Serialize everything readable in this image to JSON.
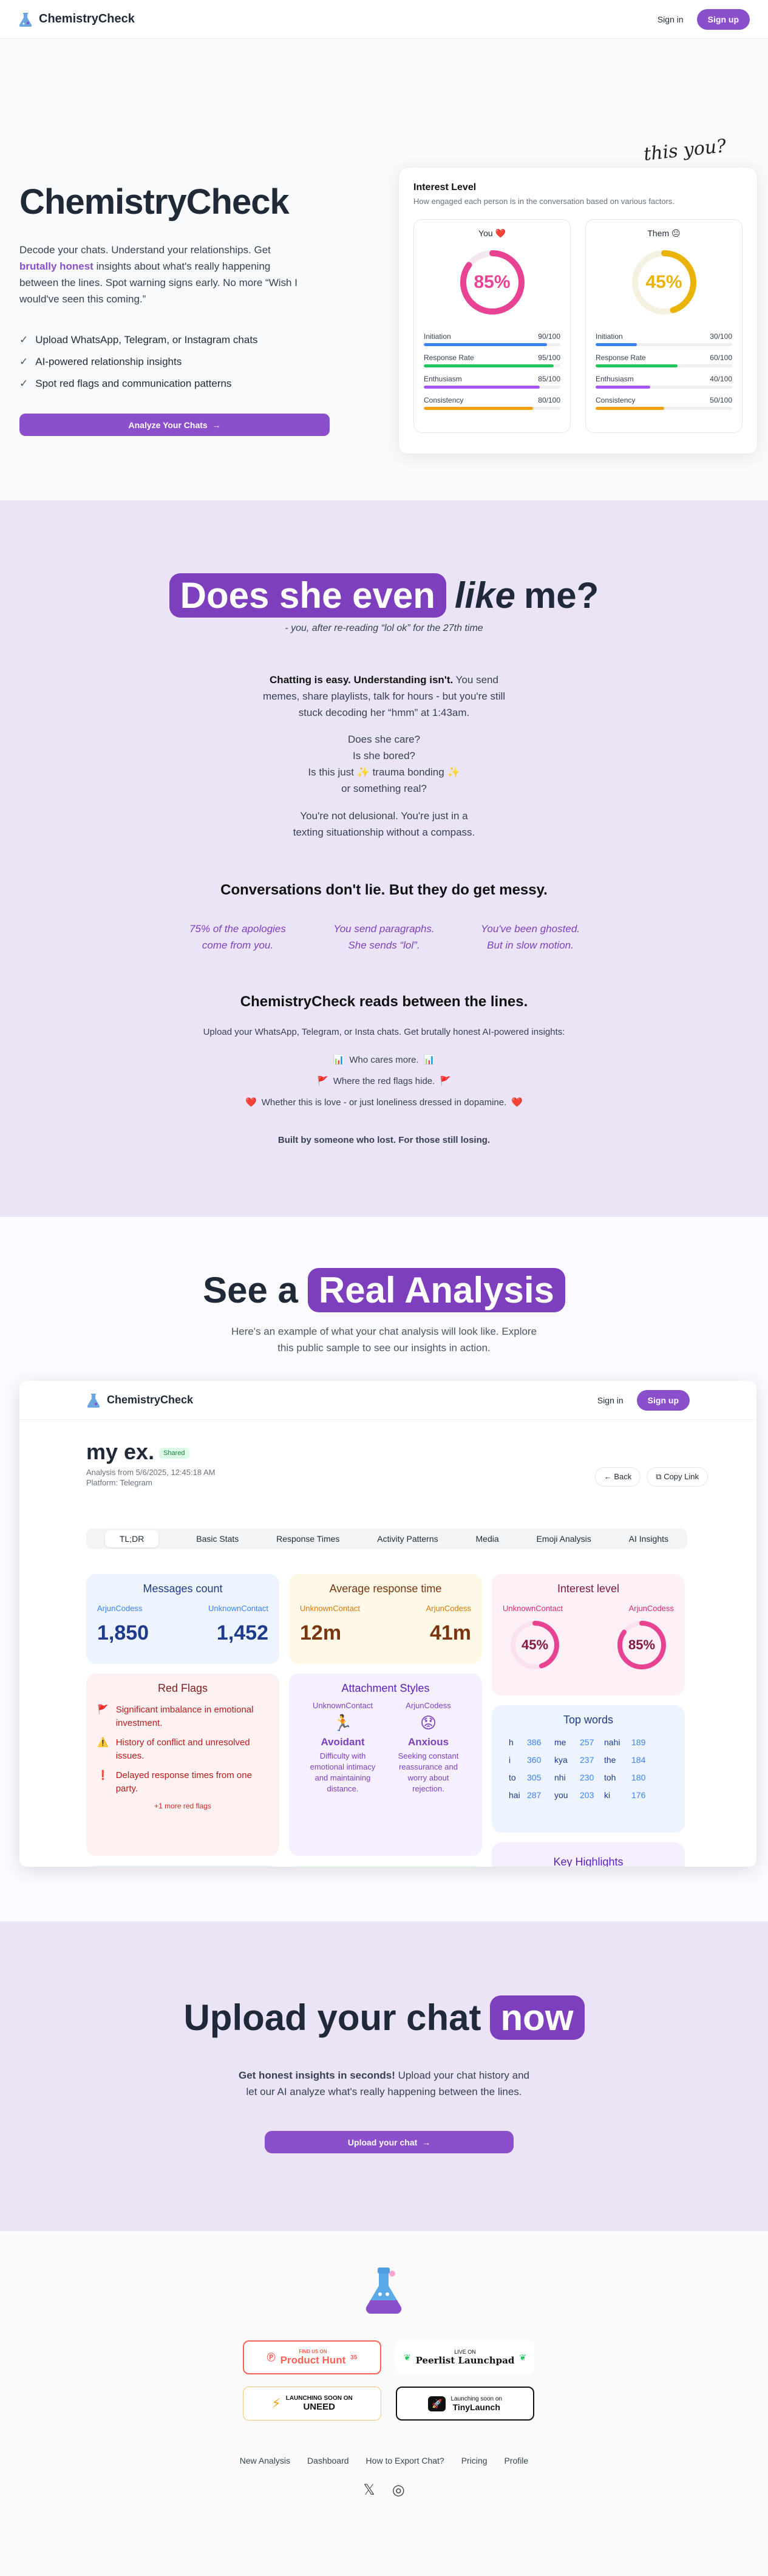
{
  "nav": {
    "brand": "ChemistryCheck",
    "signin": "Sign in",
    "signup": "Sign up"
  },
  "hero": {
    "title": "ChemistryCheck",
    "p1": "Decode your chats. Understand your relationships. Get ",
    "p_bold": "brutally honest",
    "p2": " insights about what's really happening between the lines. Spot warning signs early. No more “Wish I would've seen this coming.”",
    "checks": [
      "Upload WhatsApp, Telegram, or Instagram chats",
      "AI-powered relationship insights",
      "Spot red flags and communication patterns"
    ],
    "cta": "Analyze Your Chats"
  },
  "interest": {
    "handwritten": "this you?",
    "title": "Interest Level",
    "subtitle": "How engaged each person is in the conversation based on various factors.",
    "people": [
      {
        "name": "You ❤️",
        "percent": "85%",
        "value": 85,
        "color": "#e84393",
        "metrics": [
          {
            "label": "Initiation",
            "value": "90/100",
            "fill": 90,
            "color": "#3b82f6"
          },
          {
            "label": "Response Rate",
            "value": "95/100",
            "fill": 95,
            "color": "#22c55e"
          },
          {
            "label": "Enthusiasm",
            "value": "85/100",
            "fill": 85,
            "color": "#a855f7"
          },
          {
            "label": "Consistency",
            "value": "80/100",
            "fill": 80,
            "color": "#f59e0b"
          }
        ]
      },
      {
        "name": "Them 😐",
        "percent": "45%",
        "value": 45,
        "color": "#eab308",
        "metrics": [
          {
            "label": "Initiation",
            "value": "30/100",
            "fill": 30,
            "color": "#3b82f6"
          },
          {
            "label": "Response Rate",
            "value": "60/100",
            "fill": 60,
            "color": "#22c55e"
          },
          {
            "label": "Enthusiasm",
            "value": "40/100",
            "fill": 40,
            "color": "#a855f7"
          },
          {
            "label": "Consistency",
            "value": "50/100",
            "fill": 50,
            "color": "#f59e0b"
          }
        ]
      }
    ]
  },
  "story": {
    "head_pill": "Does she even",
    "head_em": "like",
    "head_end": "me?",
    "quote": "- you, after re-reading “lol ok” for the 27th time",
    "b1_bold": "Chatting is easy. Understanding isn't.",
    "b1_rest": " You send memes, share playlists, talk for hours - but you're still stuck decoding her “hmm” at 1:43am.",
    "b2": [
      "Does she care?",
      "Is she bored?",
      "Is this just ✨ trauma bonding ✨",
      "or something real?"
    ],
    "b3": [
      "You're not delusional. You're just in a",
      "texting situationship without a compass."
    ],
    "h2": "Conversations don't lie. But they do get messy.",
    "quotes": [
      "75% of the apologies come from you.",
      "You send paragraphs. She sends “lol”.",
      "You've been ghosted. But in slow motion."
    ],
    "h3": "ChemistryCheck reads between the lines.",
    "p3": "Upload your WhatsApp, Telegram, or Insta chats. Get brutally honest AI-powered insights:",
    "items": [
      {
        "icon": "📊",
        "text": "Who cares more."
      },
      {
        "icon": "🚩",
        "text": "Where the red flags hide."
      },
      {
        "icon": "❤️",
        "text": "Whether this is love - or just loneliness dressed in dopamine."
      }
    ],
    "closing": "Built by someone who lost. For those still losing."
  },
  "sample": {
    "head_a": "See a",
    "head_pill": "Real Analysis",
    "sub": [
      "Here's an example of what your chat analysis will look like. Explore",
      "this public sample to see our insights in action."
    ],
    "title": "my ex.",
    "shared": "Shared",
    "meta1": "Analysis from 5/6/2025, 12:45:18 AM",
    "meta2": "Platform: Telegram",
    "back": "Back",
    "copy": "Copy Link",
    "tabs": [
      "TL;DR",
      "Basic Stats",
      "Response Times",
      "Activity Patterns",
      "Media",
      "Emoji Analysis",
      "AI Insights"
    ],
    "messages": {
      "title": "Messages count",
      "a": "ArjunCodess",
      "b": "UnknownContact",
      "av": "1,850",
      "bv": "1,452"
    },
    "response": {
      "title": "Average response time",
      "a": "UnknownContact",
      "b": "ArjunCodess",
      "av": "12m",
      "bv": "41m"
    },
    "interest": {
      "title": "Interest level",
      "a": "UnknownContact",
      "b": "ArjunCodess",
      "av": "45%",
      "bv": "85%",
      "avn": 45,
      "bvn": 85
    },
    "flags": {
      "title": "Red Flags",
      "items": [
        {
          "icon": "🚩",
          "text": "Significant imbalance in emotional investment."
        },
        {
          "icon": "⚠️",
          "text": "History of conflict and unresolved issues."
        },
        {
          "icon": "❗",
          "text": "Delayed response times from one party."
        }
      ],
      "more": "+1 more red flags"
    },
    "attach": {
      "title": "Attachment Styles",
      "a": "UnknownContact",
      "b": "ArjunCodess",
      "ae": "🏃",
      "be": "😟",
      "at": "Avoidant",
      "bt": "Anxious",
      "ad": "Difficulty with emotional intimacy and maintaining distance.",
      "bd": "Seeking constant reassurance and worry about rejection."
    },
    "words": {
      "title": "Top words",
      "rows": [
        [
          "h",
          "386",
          "me",
          "257",
          "nahi",
          "189"
        ],
        [
          "i",
          "360",
          "kya",
          "237",
          "the",
          "184"
        ],
        [
          "to",
          "305",
          "nhi",
          "230",
          "toh",
          "180"
        ],
        [
          "hai",
          "287",
          "you",
          "203",
          "ki",
          "176"
        ]
      ]
    },
    "key": "Key Highlights"
  },
  "upload": {
    "head": "Upload your chat",
    "pill": "now",
    "bold": "Get honest insights in seconds!",
    "rest": " Upload your chat history and",
    "line2": "let our AI analyze what's really happening between the lines.",
    "btn": "Upload your chat"
  },
  "footer": {
    "badges": [
      {
        "top": "FIND US ON",
        "main": "Product Hunt",
        "count": "35"
      },
      {
        "top": "LIVE ON",
        "main": "Peerlist Launchpad"
      },
      {
        "top": "LAUNCHING SOON ON",
        "main": "UNEED"
      },
      {
        "top": "Launching soon on",
        "main": "TinyLaunch"
      }
    ],
    "links": [
      "New Analysis",
      "Dashboard",
      "How to Export Chat?",
      "Pricing",
      "Profile"
    ]
  }
}
